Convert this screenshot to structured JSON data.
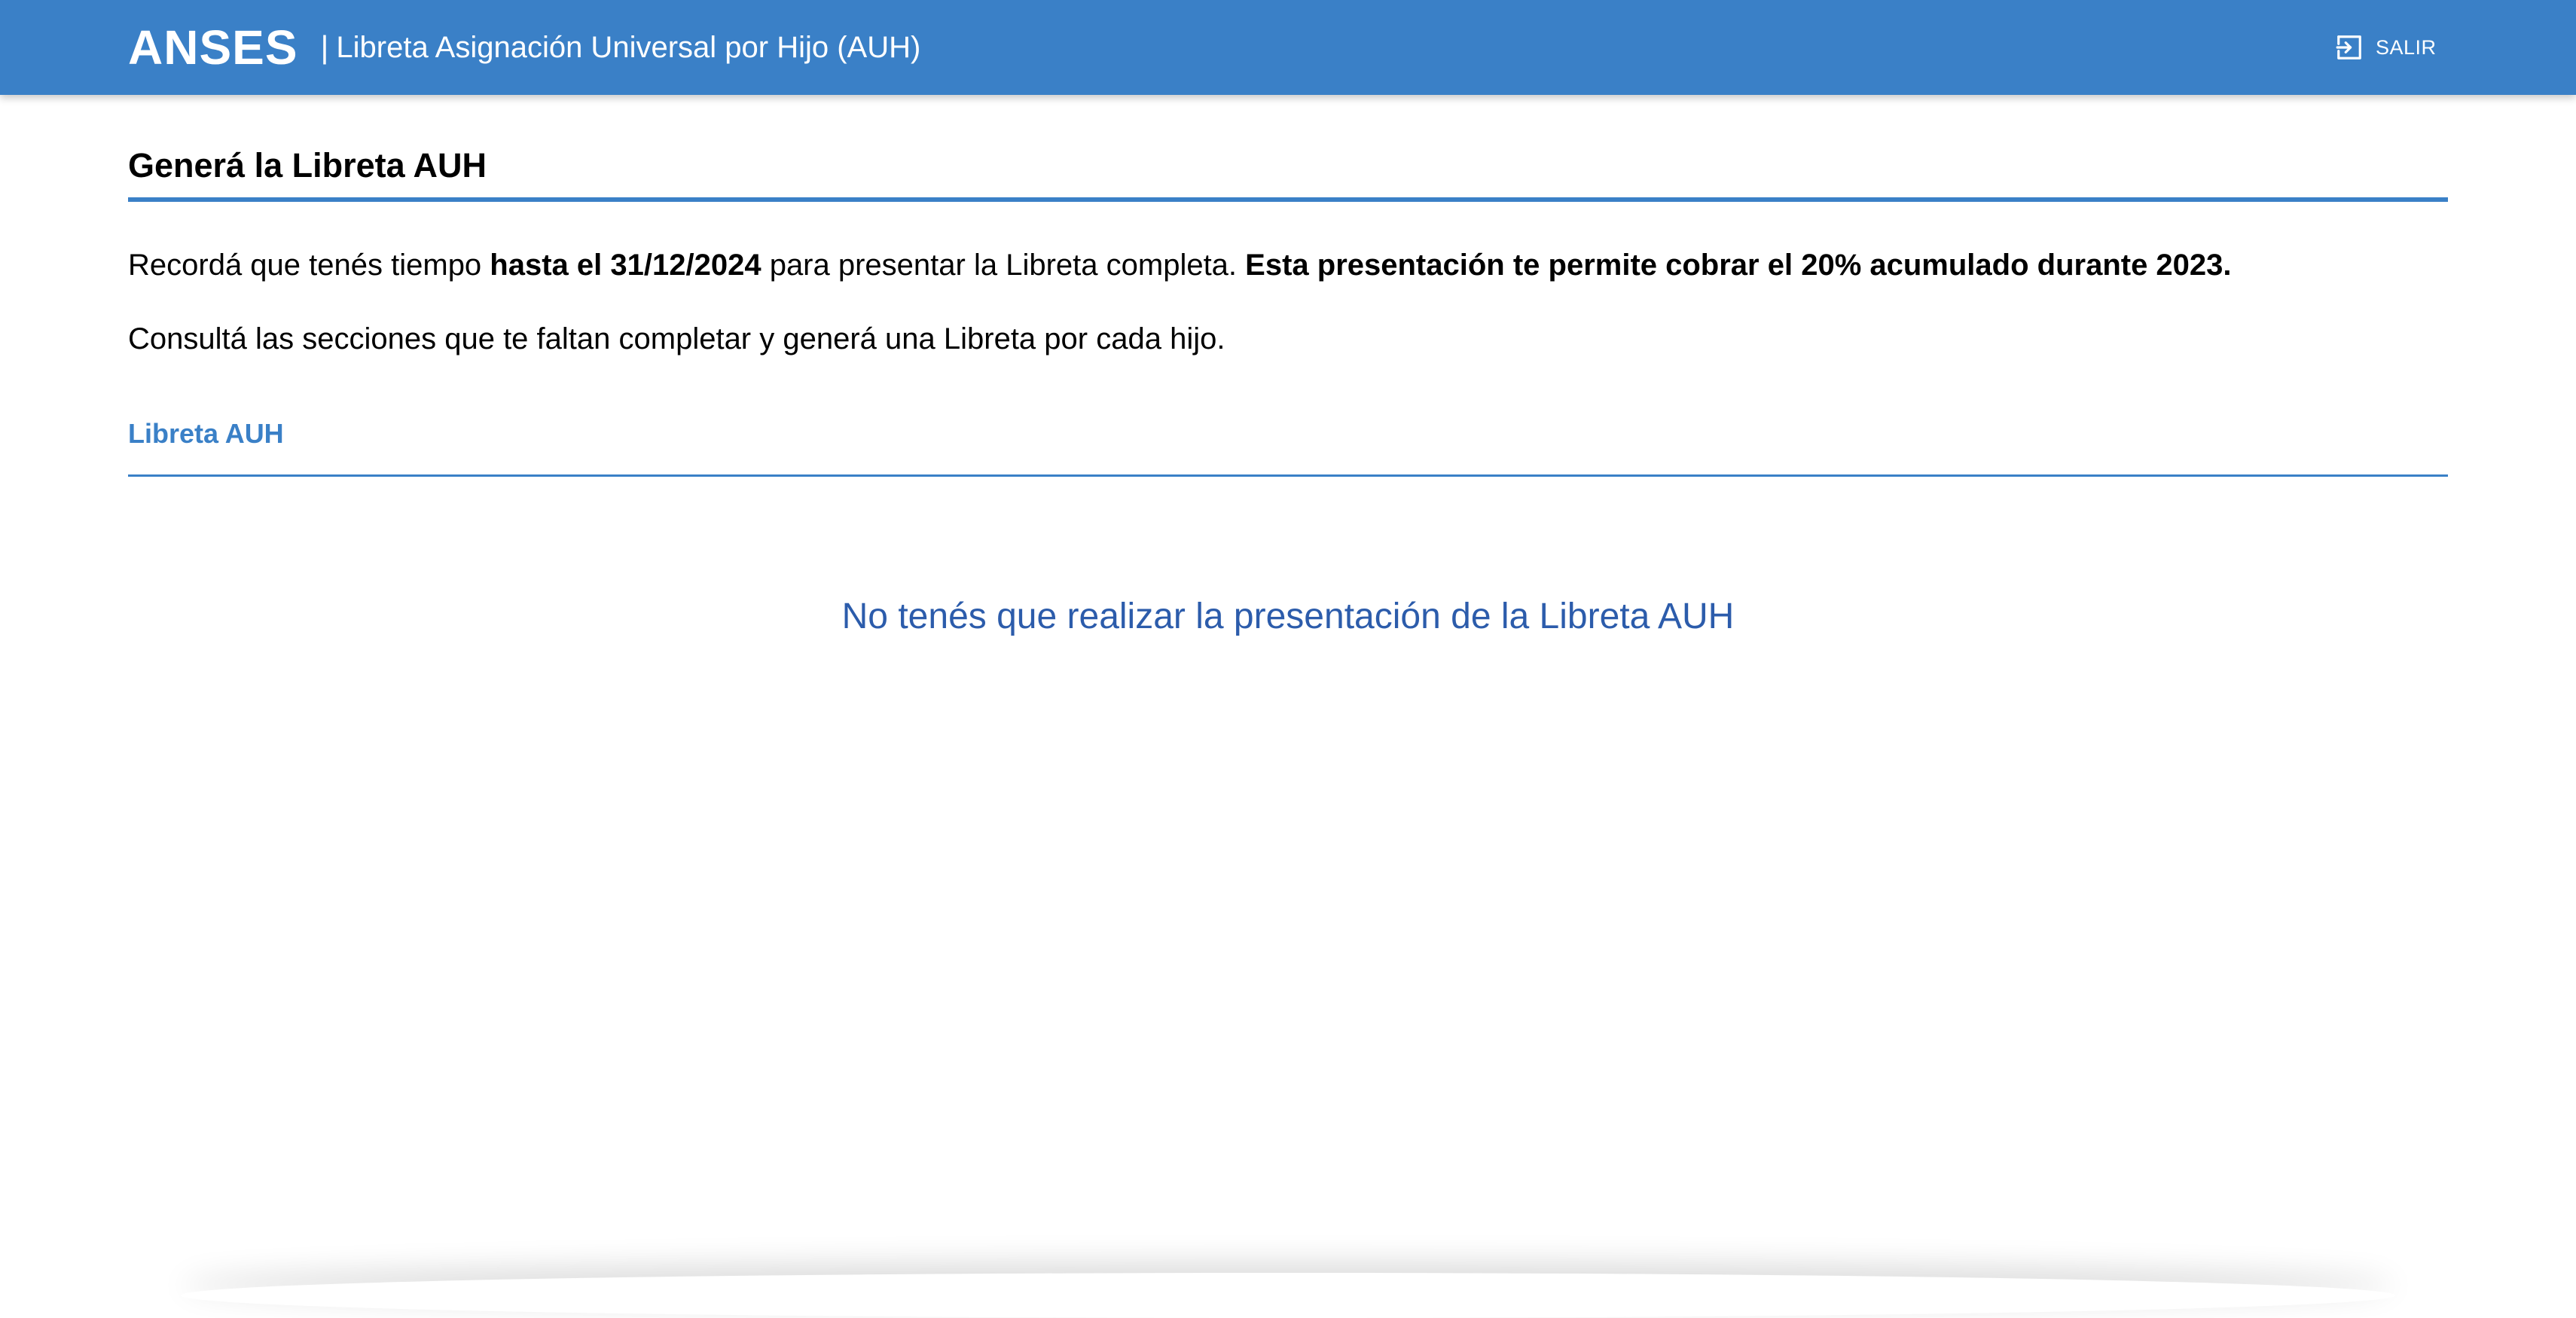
{
  "header": {
    "brand": "ANSES",
    "separator": "|",
    "subtitle": "Libreta Asignación Universal por Hijo (AUH)",
    "logout_label": "SALIR",
    "logout_icon": "logout-icon"
  },
  "main": {
    "title": "Generá la Libreta AUH",
    "notice": {
      "part1": "Recordá que tenés tiempo ",
      "deadline": "hasta el 31/12/2024",
      "part2": " para presentar la Libreta completa. ",
      "highlight": "Esta presentación te permite cobrar el 20% acumulado durante 2023."
    },
    "instruction": "Consultá las secciones que te faltan completar y generá una Libreta por cada hijo.",
    "tab_label": "Libreta AUH",
    "empty_message": "No tenés que realizar la presentación de la Libreta AUH"
  },
  "colors": {
    "brand_blue": "#3a80c7",
    "message_blue": "#2c5cab",
    "text": "#000000",
    "background": "#ffffff"
  }
}
